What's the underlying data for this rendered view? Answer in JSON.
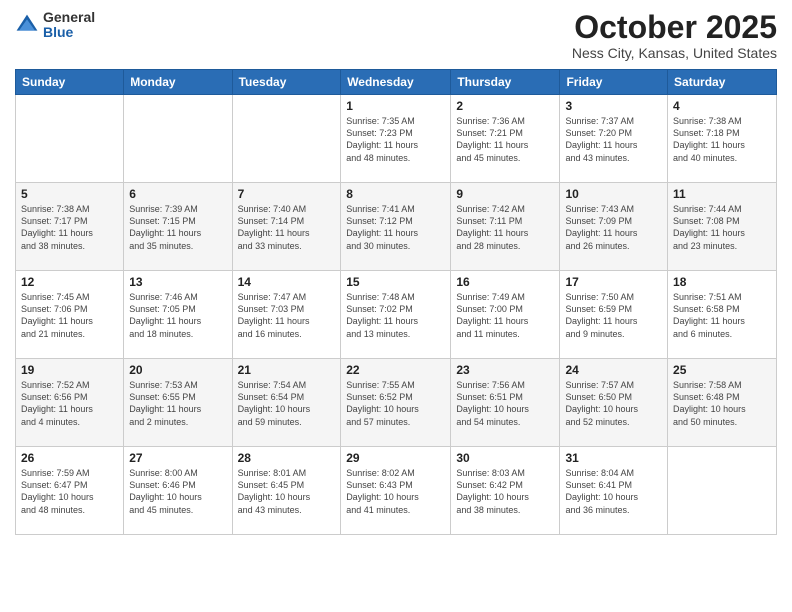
{
  "header": {
    "logo": {
      "general": "General",
      "blue": "Blue"
    },
    "title": "October 2025",
    "location": "Ness City, Kansas, United States"
  },
  "weekdays": [
    "Sunday",
    "Monday",
    "Tuesday",
    "Wednesday",
    "Thursday",
    "Friday",
    "Saturday"
  ],
  "weeks": [
    [
      {
        "day": "",
        "info": ""
      },
      {
        "day": "",
        "info": ""
      },
      {
        "day": "",
        "info": ""
      },
      {
        "day": "1",
        "info": "Sunrise: 7:35 AM\nSunset: 7:23 PM\nDaylight: 11 hours\nand 48 minutes."
      },
      {
        "day": "2",
        "info": "Sunrise: 7:36 AM\nSunset: 7:21 PM\nDaylight: 11 hours\nand 45 minutes."
      },
      {
        "day": "3",
        "info": "Sunrise: 7:37 AM\nSunset: 7:20 PM\nDaylight: 11 hours\nand 43 minutes."
      },
      {
        "day": "4",
        "info": "Sunrise: 7:38 AM\nSunset: 7:18 PM\nDaylight: 11 hours\nand 40 minutes."
      }
    ],
    [
      {
        "day": "5",
        "info": "Sunrise: 7:38 AM\nSunset: 7:17 PM\nDaylight: 11 hours\nand 38 minutes."
      },
      {
        "day": "6",
        "info": "Sunrise: 7:39 AM\nSunset: 7:15 PM\nDaylight: 11 hours\nand 35 minutes."
      },
      {
        "day": "7",
        "info": "Sunrise: 7:40 AM\nSunset: 7:14 PM\nDaylight: 11 hours\nand 33 minutes."
      },
      {
        "day": "8",
        "info": "Sunrise: 7:41 AM\nSunset: 7:12 PM\nDaylight: 11 hours\nand 30 minutes."
      },
      {
        "day": "9",
        "info": "Sunrise: 7:42 AM\nSunset: 7:11 PM\nDaylight: 11 hours\nand 28 minutes."
      },
      {
        "day": "10",
        "info": "Sunrise: 7:43 AM\nSunset: 7:09 PM\nDaylight: 11 hours\nand 26 minutes."
      },
      {
        "day": "11",
        "info": "Sunrise: 7:44 AM\nSunset: 7:08 PM\nDaylight: 11 hours\nand 23 minutes."
      }
    ],
    [
      {
        "day": "12",
        "info": "Sunrise: 7:45 AM\nSunset: 7:06 PM\nDaylight: 11 hours\nand 21 minutes."
      },
      {
        "day": "13",
        "info": "Sunrise: 7:46 AM\nSunset: 7:05 PM\nDaylight: 11 hours\nand 18 minutes."
      },
      {
        "day": "14",
        "info": "Sunrise: 7:47 AM\nSunset: 7:03 PM\nDaylight: 11 hours\nand 16 minutes."
      },
      {
        "day": "15",
        "info": "Sunrise: 7:48 AM\nSunset: 7:02 PM\nDaylight: 11 hours\nand 13 minutes."
      },
      {
        "day": "16",
        "info": "Sunrise: 7:49 AM\nSunset: 7:00 PM\nDaylight: 11 hours\nand 11 minutes."
      },
      {
        "day": "17",
        "info": "Sunrise: 7:50 AM\nSunset: 6:59 PM\nDaylight: 11 hours\nand 9 minutes."
      },
      {
        "day": "18",
        "info": "Sunrise: 7:51 AM\nSunset: 6:58 PM\nDaylight: 11 hours\nand 6 minutes."
      }
    ],
    [
      {
        "day": "19",
        "info": "Sunrise: 7:52 AM\nSunset: 6:56 PM\nDaylight: 11 hours\nand 4 minutes."
      },
      {
        "day": "20",
        "info": "Sunrise: 7:53 AM\nSunset: 6:55 PM\nDaylight: 11 hours\nand 2 minutes."
      },
      {
        "day": "21",
        "info": "Sunrise: 7:54 AM\nSunset: 6:54 PM\nDaylight: 10 hours\nand 59 minutes."
      },
      {
        "day": "22",
        "info": "Sunrise: 7:55 AM\nSunset: 6:52 PM\nDaylight: 10 hours\nand 57 minutes."
      },
      {
        "day": "23",
        "info": "Sunrise: 7:56 AM\nSunset: 6:51 PM\nDaylight: 10 hours\nand 54 minutes."
      },
      {
        "day": "24",
        "info": "Sunrise: 7:57 AM\nSunset: 6:50 PM\nDaylight: 10 hours\nand 52 minutes."
      },
      {
        "day": "25",
        "info": "Sunrise: 7:58 AM\nSunset: 6:48 PM\nDaylight: 10 hours\nand 50 minutes."
      }
    ],
    [
      {
        "day": "26",
        "info": "Sunrise: 7:59 AM\nSunset: 6:47 PM\nDaylight: 10 hours\nand 48 minutes."
      },
      {
        "day": "27",
        "info": "Sunrise: 8:00 AM\nSunset: 6:46 PM\nDaylight: 10 hours\nand 45 minutes."
      },
      {
        "day": "28",
        "info": "Sunrise: 8:01 AM\nSunset: 6:45 PM\nDaylight: 10 hours\nand 43 minutes."
      },
      {
        "day": "29",
        "info": "Sunrise: 8:02 AM\nSunset: 6:43 PM\nDaylight: 10 hours\nand 41 minutes."
      },
      {
        "day": "30",
        "info": "Sunrise: 8:03 AM\nSunset: 6:42 PM\nDaylight: 10 hours\nand 38 minutes."
      },
      {
        "day": "31",
        "info": "Sunrise: 8:04 AM\nSunset: 6:41 PM\nDaylight: 10 hours\nand 36 minutes."
      },
      {
        "day": "",
        "info": ""
      }
    ]
  ]
}
